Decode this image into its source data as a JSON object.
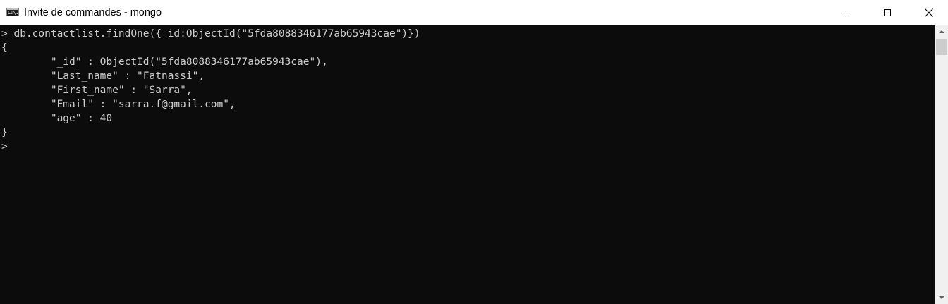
{
  "window": {
    "title": "Invite de commandes - mongo",
    "icon": "console-app-icon",
    "icon_glyph": "C:\\.",
    "controls": [
      "minimize-icon",
      "maximize-icon",
      "close-icon"
    ],
    "close_glyph": "✕"
  },
  "console": {
    "lines": [
      "> db.contactlist.findOne({_id:ObjectId(\"5fda8088346177ab65943cae\")})",
      "{",
      "        \"_id\" : ObjectId(\"5fda8088346177ab65943cae\"),",
      "        \"Last_name\" : \"Fatnassi\",",
      "        \"First_name\" : \"Sarra\",",
      "        \"Email\" : \"sarra.f@gmail.com\",",
      "        \"age\" : 40",
      "}",
      ">"
    ],
    "colors": {
      "background": "#0c0c0c",
      "text": "#cccccc"
    }
  },
  "scrollbar": {
    "up_icon": "arrow-up-icon",
    "down_icon": "arrow-down-icon"
  }
}
